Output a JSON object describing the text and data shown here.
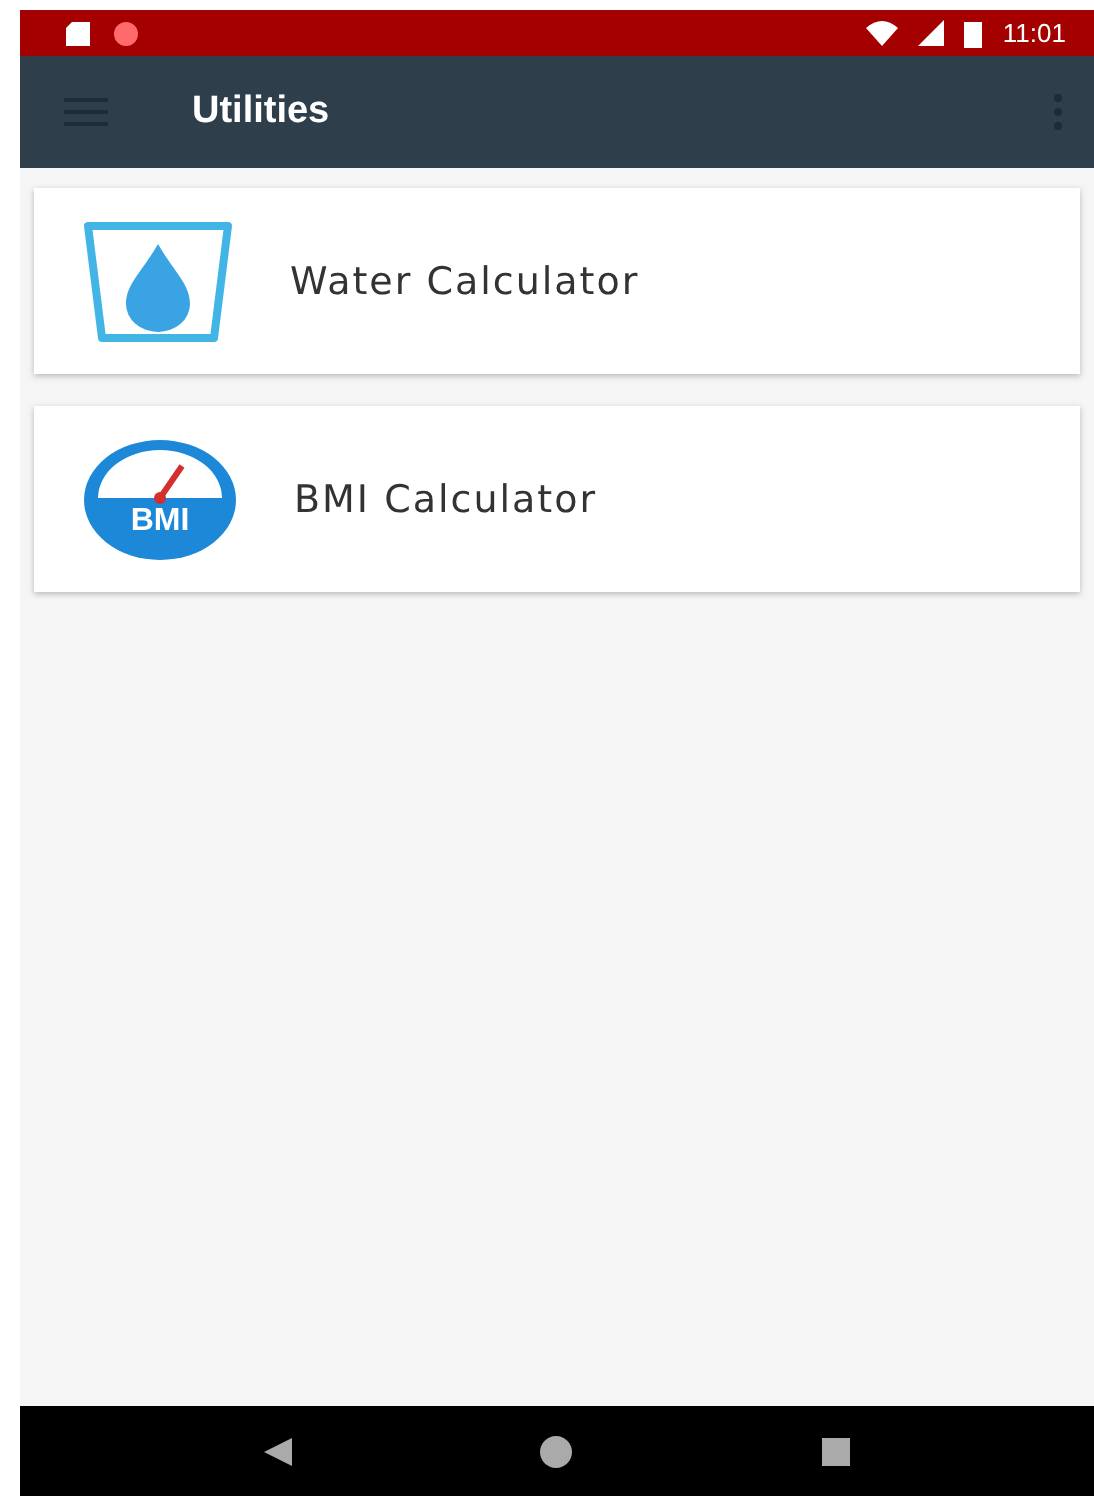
{
  "status_bar": {
    "time": "11:01"
  },
  "app_bar": {
    "title": "Utilities"
  },
  "items": [
    {
      "kind": "water",
      "label": "Water Calculator"
    },
    {
      "kind": "bmi",
      "label": "BMI Calculator",
      "icon_text": "BMI"
    }
  ]
}
